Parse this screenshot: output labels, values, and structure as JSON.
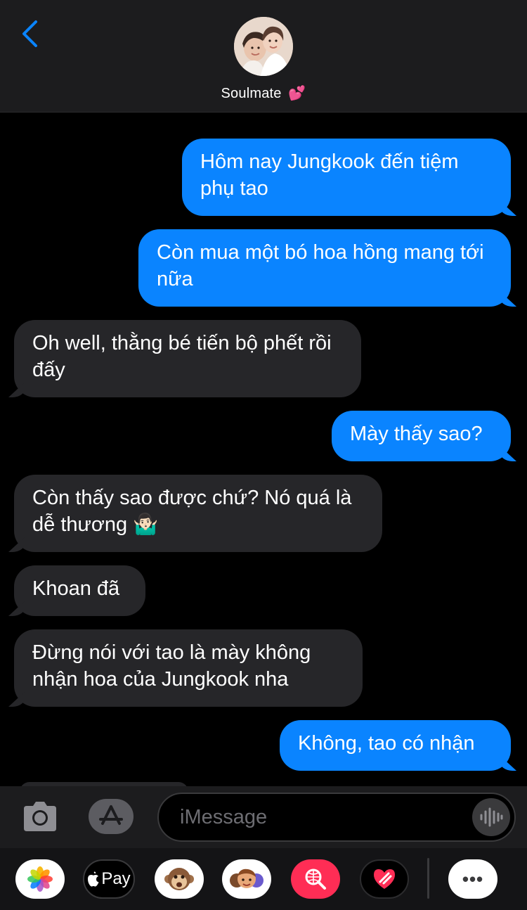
{
  "header": {
    "contact_name": "Soulmate",
    "contact_emoji": "💕"
  },
  "messages": [
    {
      "direction": "sent",
      "text": "Hôm nay Jungkook đến tiệm phụ tao"
    },
    {
      "direction": "sent",
      "text": "Còn mua một bó hoa hồng mang tới nữa"
    },
    {
      "direction": "received",
      "text": "Oh well, thằng bé tiến bộ phết rồi đấy"
    },
    {
      "direction": "sent",
      "text": "Mày thấy sao?"
    },
    {
      "direction": "received",
      "text": "Còn thấy sao được chứ? Nó quá là dễ thương 🤷🏻‍♂️"
    },
    {
      "direction": "received",
      "text": "Khoan đã"
    },
    {
      "direction": "received",
      "text": "Đừng nói với tao là mày không nhận hoa của Jungkook nha"
    },
    {
      "direction": "sent",
      "text": "Không, tao có nhận"
    }
  ],
  "input": {
    "placeholder": "iMessage"
  },
  "app_drawer": {
    "apple_pay_label": "Pay",
    "more_label": "•••"
  },
  "colors": {
    "sent_bubble": "#0a84ff",
    "received_bubble": "#262629",
    "header_bg": "#1c1c1e",
    "accent": "#0a84ff"
  }
}
